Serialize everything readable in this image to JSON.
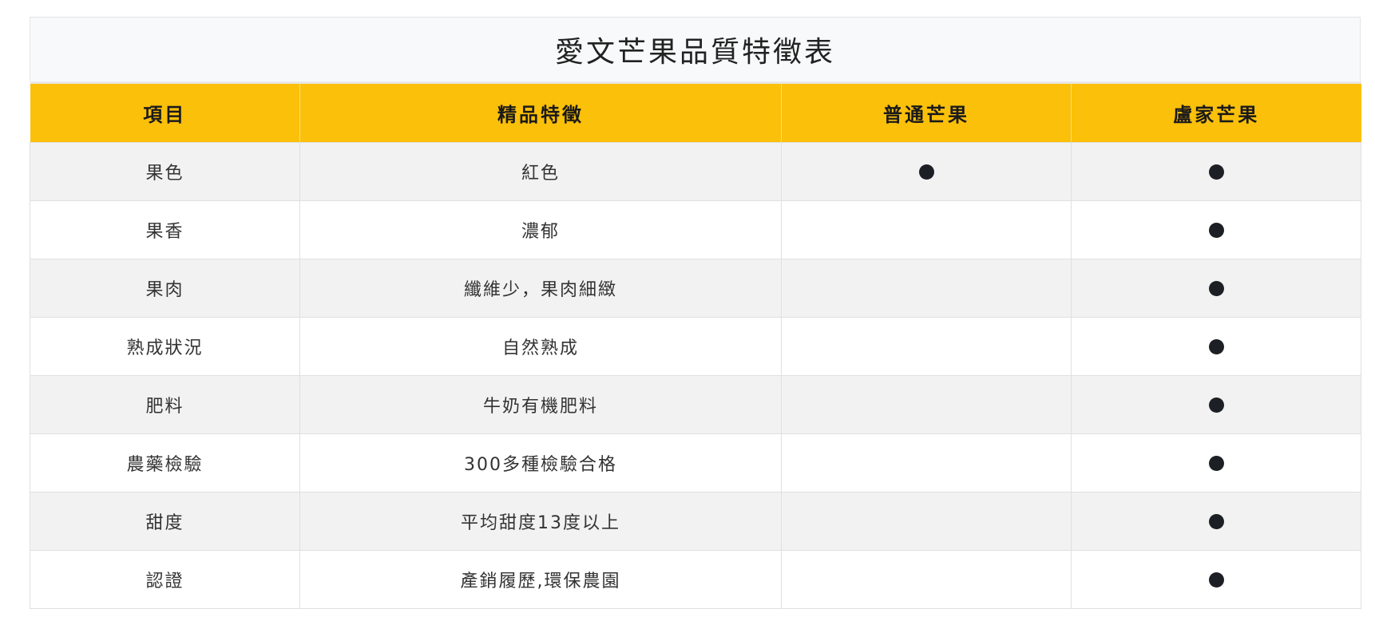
{
  "table": {
    "title": "愛文芒果品質特徵表",
    "headers": [
      "項目",
      "精品特徵",
      "普通芒果",
      "盧家芒果"
    ],
    "rows": [
      {
        "item": "果色",
        "feature": "紅色",
        "normal": true,
        "lujia": true
      },
      {
        "item": "果香",
        "feature": "濃郁",
        "normal": false,
        "lujia": true
      },
      {
        "item": "果肉",
        "feature": "纖維少，果肉細緻",
        "normal": false,
        "lujia": true
      },
      {
        "item": "熟成狀況",
        "feature": "自然熟成",
        "normal": false,
        "lujia": true
      },
      {
        "item": "肥料",
        "feature": "牛奶有機肥料",
        "normal": false,
        "lujia": true
      },
      {
        "item": "農藥檢驗",
        "feature": "300多種檢驗合格",
        "normal": false,
        "lujia": true
      },
      {
        "item": "甜度",
        "feature": "平均甜度13度以上",
        "normal": false,
        "lujia": true
      },
      {
        "item": "認證",
        "feature": "產銷履歷,環保農園",
        "normal": false,
        "lujia": true
      }
    ]
  },
  "colors": {
    "header_bg": "#fbc00a",
    "caption_bg": "#f7f9fa",
    "stripe_bg": "#f2f2f2",
    "dot": "#1c1f24"
  },
  "icons": {
    "check": "filled-circle-icon"
  }
}
